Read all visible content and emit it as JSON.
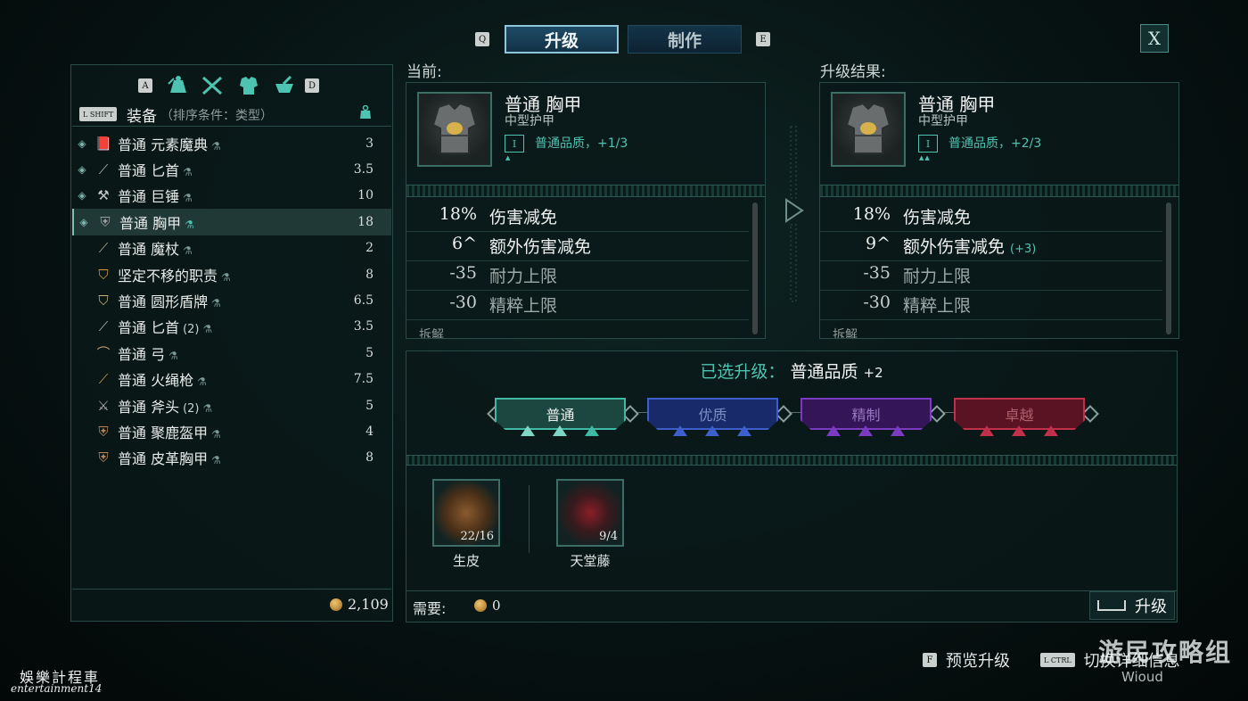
{
  "top_tabs": {
    "prev_key": "Q",
    "next_key": "E",
    "tabs": [
      {
        "label": "升级",
        "active": true
      },
      {
        "label": "制作",
        "active": false
      }
    ],
    "close_label": "X"
  },
  "inventory": {
    "cat_prev_key": "A",
    "cat_next_key": "D",
    "categories": [
      "potion-bag-icon",
      "crossed-weapons-icon",
      "armor-icon",
      "pestle-icon"
    ],
    "sort_key": "L SHIFT",
    "title": "装备",
    "sort_hint": "（排序条件：类型）",
    "weight_icon": "weight-icon",
    "items": [
      {
        "name": "普通 元素魔典",
        "count": "",
        "weight": "3",
        "marked": true,
        "icon": "grimoire-icon"
      },
      {
        "name": "普通 匕首",
        "count": "",
        "weight": "3.5",
        "marked": true,
        "icon": "dagger-icon"
      },
      {
        "name": "普通 巨锤",
        "count": "",
        "weight": "10",
        "marked": true,
        "icon": "hammer-icon"
      },
      {
        "name": "普通 胸甲",
        "count": "",
        "weight": "18",
        "marked": true,
        "selected": true,
        "icon": "chestplate-icon"
      },
      {
        "name": "普通 魔杖",
        "count": "",
        "weight": "2",
        "marked": false,
        "icon": "wand-icon"
      },
      {
        "name": "坚定不移的职责",
        "count": "",
        "weight": "8",
        "marked": false,
        "icon": "shield-icon"
      },
      {
        "name": "普通 圆形盾牌",
        "count": "",
        "weight": "6.5",
        "marked": false,
        "icon": "round-shield-icon"
      },
      {
        "name": "普通 匕首",
        "count": "(2)",
        "weight": "3.5",
        "marked": false,
        "icon": "dagger-icon"
      },
      {
        "name": "普通 弓",
        "count": "",
        "weight": "5",
        "marked": false,
        "icon": "bow-icon"
      },
      {
        "name": "普通 火绳枪",
        "count": "",
        "weight": "7.5",
        "marked": false,
        "icon": "musket-icon"
      },
      {
        "name": "普通 斧头",
        "count": "(2)",
        "weight": "5",
        "marked": false,
        "icon": "axe-icon"
      },
      {
        "name": "普通 聚鹿盔甲",
        "count": "",
        "weight": "4",
        "marked": false,
        "icon": "armor-icon"
      },
      {
        "name": "普通 皮革胸甲",
        "count": "",
        "weight": "8",
        "marked": false,
        "icon": "armor-icon"
      }
    ],
    "gold": "2,109"
  },
  "current": {
    "label": "当前:",
    "item_name": "普通 胸甲",
    "item_type": "中型护甲",
    "tier": "I",
    "quality": "普通品质，+1/3",
    "stats": [
      {
        "value": "18%",
        "name": "伤害减免",
        "delta": "",
        "dim": false
      },
      {
        "value": "6^",
        "name": "额外伤害减免",
        "delta": "",
        "dim": false
      },
      {
        "value": "-35",
        "name": "耐力上限",
        "delta": "",
        "dim": true
      },
      {
        "value": "-30",
        "name": "精粹上限",
        "delta": "",
        "dim": true
      }
    ],
    "dismantle": "拆解"
  },
  "result": {
    "label": "升级结果:",
    "item_name": "普通 胸甲",
    "item_type": "中型护甲",
    "tier": "I",
    "quality": "普通品质，+2/3",
    "stats": [
      {
        "value": "18%",
        "name": "伤害减免",
        "delta": "",
        "dim": false
      },
      {
        "value": "9^",
        "name": "额外伤害减免",
        "delta": "(+3)",
        "dim": false
      },
      {
        "value": "-35",
        "name": "耐力上限",
        "delta": "",
        "dim": true
      },
      {
        "value": "-30",
        "name": "精粹上限",
        "delta": "",
        "dim": true
      }
    ],
    "dismantle": "拆解"
  },
  "upgrade": {
    "selected_label": "已选升级：",
    "selected_value": "普通品质",
    "selected_plus": "+2",
    "tiers": [
      {
        "label": "普通",
        "color": "#3fb9a4",
        "fill": "#1c4640",
        "text": "#eaf2ef"
      },
      {
        "label": "优质",
        "color": "#3c5fcc",
        "fill": "#182a6a",
        "text": "#7c8fc6"
      },
      {
        "label": "精制",
        "color": "#7a3bc0",
        "fill": "#331558",
        "text": "#9877bf"
      },
      {
        "label": "卓越",
        "color": "#c1304a",
        "fill": "#5a1322",
        "text": "#b0606e"
      }
    ],
    "materials": [
      {
        "name": "生皮",
        "count": "22/16",
        "icon": "hide-icon"
      },
      {
        "name": "天堂藤",
        "count": "9/4",
        "icon": "vine-icon"
      }
    ],
    "need_label": "需要:",
    "need_value": "0",
    "button_label": "升级"
  },
  "hints": {
    "preview_key": "F",
    "preview_label": "预览升级",
    "toggle_key": "L CTRL",
    "toggle_label": "切换详细信息"
  },
  "watermarks": {
    "line1": "娛樂計程車",
    "line2": "entertainment14",
    "logo": "游民攻略组",
    "logo_sub": "Wioud"
  }
}
